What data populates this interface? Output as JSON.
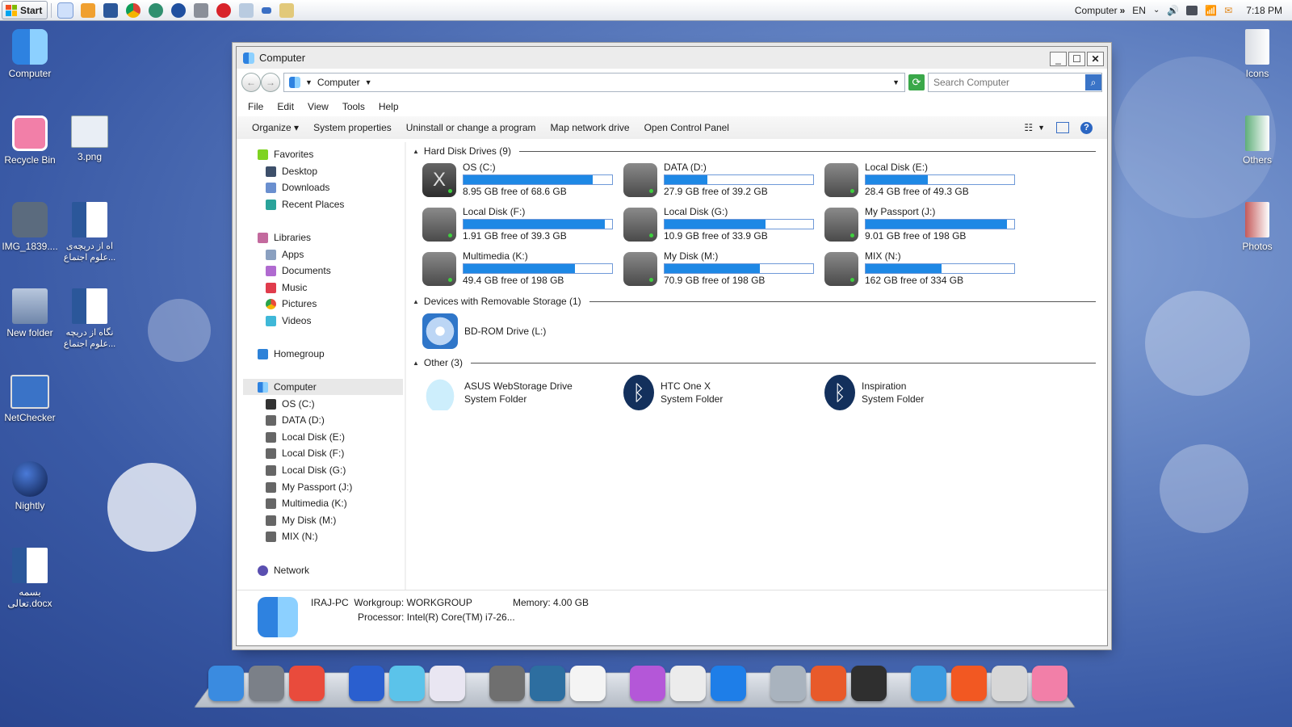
{
  "taskbar": {
    "start_label": "Start",
    "tray_computer": "Computer",
    "tray_expand": "»",
    "lang": "EN",
    "clock": "7:18 PM",
    "quick_launch": [
      "explorer-icon",
      "media-player-icon",
      "word-icon",
      "chrome-icon",
      "sync-icon",
      "browser-globe-icon",
      "calendar-icon",
      "opera-icon",
      "notepad-icon",
      "tray-arrow-icon",
      "grid-app-icon"
    ]
  },
  "desktop": {
    "left_icons": [
      {
        "label": "Computer",
        "name": "computer-icon",
        "color": "#2e82e0"
      },
      {
        "label": "Recycle Bin",
        "name": "recycle-bin-icon",
        "color": "#f27fa8"
      },
      {
        "label": "3.png",
        "name": "image-file-icon",
        "color": "#e9eef5"
      },
      {
        "label": "IMG_1839....",
        "name": "camera-icon",
        "color": "#5b6b7e"
      },
      {
        "label": "اه از دریچه‌ی‌ علوم اجتماع...",
        "name": "word-doc-icon",
        "color": "#2b579a"
      },
      {
        "label": "New folder",
        "name": "folder-icon",
        "color": "#8fa3c0"
      },
      {
        "label": "نگاه از دریچه علوم اجتماع...",
        "name": "word-doc-icon",
        "color": "#2b579a"
      },
      {
        "label": "NetChecker",
        "name": "netchecker-icon",
        "color": "#3a73c7"
      },
      {
        "label": "Nightly",
        "name": "nightly-icon",
        "color": "#16306b"
      },
      {
        "label": "بسمه تعالی.docx",
        "name": "word-doc-icon",
        "color": "#2b579a"
      }
    ],
    "right_icons": [
      {
        "label": "Icons",
        "name": "icons-folder-icon"
      },
      {
        "label": "Others",
        "name": "others-folder-icon"
      },
      {
        "label": "Photos",
        "name": "photos-folder-icon"
      }
    ]
  },
  "window": {
    "title": "Computer",
    "address": "Computer",
    "search_placeholder": "Search Computer",
    "menu": [
      "File",
      "Edit",
      "View",
      "Tools",
      "Help"
    ],
    "commands": [
      "Organize ▾",
      "System properties",
      "Uninstall or change a program",
      "Map network drive",
      "Open Control Panel"
    ]
  },
  "nav": {
    "favorites": "Favorites",
    "fav_items": [
      "Desktop",
      "Downloads",
      "Recent Places"
    ],
    "libraries": "Libraries",
    "lib_items": [
      "Apps",
      "Documents",
      "Music",
      "Pictures",
      "Videos"
    ],
    "homegroup": "Homegroup",
    "computer": "Computer",
    "drives": [
      "OS (C:)",
      "DATA (D:)",
      "Local Disk (E:)",
      "Local Disk (F:)",
      "Local Disk (G:)",
      "My Passport (J:)",
      "Multimedia (K:)",
      "My Disk (M:)",
      "MIX (N:)"
    ],
    "network": "Network"
  },
  "content": {
    "hdd_header": "Hard Disk Drives (9)",
    "drives": [
      {
        "name": "OS (C:)",
        "free": "8.95 GB free of 68.6 GB",
        "used_fraction": 0.87,
        "osx": true
      },
      {
        "name": "DATA (D:)",
        "free": "27.9 GB free of 39.2 GB",
        "used_fraction": 0.29
      },
      {
        "name": "Local Disk (E:)",
        "free": "28.4 GB free of 49.3 GB",
        "used_fraction": 0.42
      },
      {
        "name": "Local Disk (F:)",
        "free": "1.91 GB free of 39.3 GB",
        "used_fraction": 0.95
      },
      {
        "name": "Local Disk (G:)",
        "free": "10.9 GB free of 33.9 GB",
        "used_fraction": 0.68
      },
      {
        "name": "My Passport (J:)",
        "free": "9.01 GB free of 198 GB",
        "used_fraction": 0.95
      },
      {
        "name": "Multimedia (K:)",
        "free": "49.4 GB free of 198 GB",
        "used_fraction": 0.75
      },
      {
        "name": "My Disk (M:)",
        "free": "70.9 GB free of 198 GB",
        "used_fraction": 0.64
      },
      {
        "name": "MIX (N:)",
        "free": "162 GB free of 334 GB",
        "used_fraction": 0.51
      }
    ],
    "removable_header": "Devices with Removable Storage (1)",
    "removable": "BD-ROM Drive (L:)",
    "other_header": "Other (3)",
    "other": [
      {
        "name": "ASUS WebStorage Drive",
        "type": "System Folder"
      },
      {
        "name": "HTC One X",
        "type": "System Folder"
      },
      {
        "name": "Inspiration",
        "type": "System Folder"
      }
    ]
  },
  "details": {
    "pc": "IRAJ-PC",
    "workgroup_label": "Workgroup:",
    "workgroup": "WORKGROUP",
    "memory_label": "Memory:",
    "memory": "4.00 GB",
    "processor_label": "Processor:",
    "processor": "Intel(R) Core(TM) i7-26..."
  },
  "dock": [
    {
      "name": "finder-icon",
      "color": "#3a8be0"
    },
    {
      "name": "system-preferences-icon",
      "color": "#7b8088"
    },
    {
      "name": "color-picker-icon",
      "color": "#e94b3c"
    },
    {
      "name": "globe-icon",
      "color": "#2a5fcf"
    },
    {
      "name": "clapperboard-icon",
      "color": "#5bc3ea"
    },
    {
      "name": "pen-app-icon",
      "color": "#e9e6f2"
    },
    {
      "name": "hard-drive-icon",
      "color": "#6f6f6f"
    },
    {
      "name": "mavericks-icon",
      "color": "#2d6ea0"
    },
    {
      "name": "osx-icon",
      "color": "#f4f4f4"
    },
    {
      "name": "itunes-icon",
      "color": "#b457d8"
    },
    {
      "name": "icloud-icon",
      "color": "#ececec"
    },
    {
      "name": "app-store-icon",
      "color": "#1e7ee8"
    },
    {
      "name": "drive-utility-icon",
      "color": "#a9b3be"
    },
    {
      "name": "launchpad-icon",
      "color": "#e85a2a"
    },
    {
      "name": "dashboard-icon",
      "color": "#2f2f2f"
    },
    {
      "name": "info-icon",
      "color": "#3c9be0"
    },
    {
      "name": "power-icon",
      "color": "#f25822"
    },
    {
      "name": "app-utility-icon",
      "color": "#d7d7d7"
    },
    {
      "name": "trash-icon",
      "color": "#f27fa8"
    }
  ],
  "colors": {
    "accent": "#1e88e5",
    "selection": "#e8e8e8"
  }
}
